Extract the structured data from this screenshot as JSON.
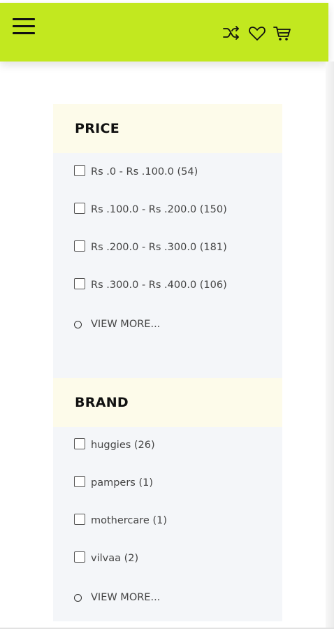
{
  "header": {
    "menu_icon": "hamburger-menu-icon",
    "icons": [
      "shuffle-compare-icon",
      "heart-wishlist-icon",
      "cart-icon"
    ],
    "accent_color": "#c2e81f"
  },
  "filters": {
    "price": {
      "title": "PRICE",
      "options": [
        {
          "label": "Rs .0 - Rs .100.0 (54)",
          "checked": false
        },
        {
          "label": "Rs .100.0 - Rs .200.0 (150)",
          "checked": false
        },
        {
          "label": "Rs .200.0 - Rs .300.0 (181)",
          "checked": false
        },
        {
          "label": "Rs .300.0 - Rs .400.0 (106)",
          "checked": false
        }
      ],
      "view_more": "VIEW MORE..."
    },
    "brand": {
      "title": "BRAND",
      "options": [
        {
          "label": "huggies (26)",
          "checked": false
        },
        {
          "label": "pampers (1)",
          "checked": false
        },
        {
          "label": "mothercare (1)",
          "checked": false
        },
        {
          "label": "vilvaa (2)",
          "checked": false
        }
      ],
      "view_more": "VIEW MORE..."
    }
  }
}
